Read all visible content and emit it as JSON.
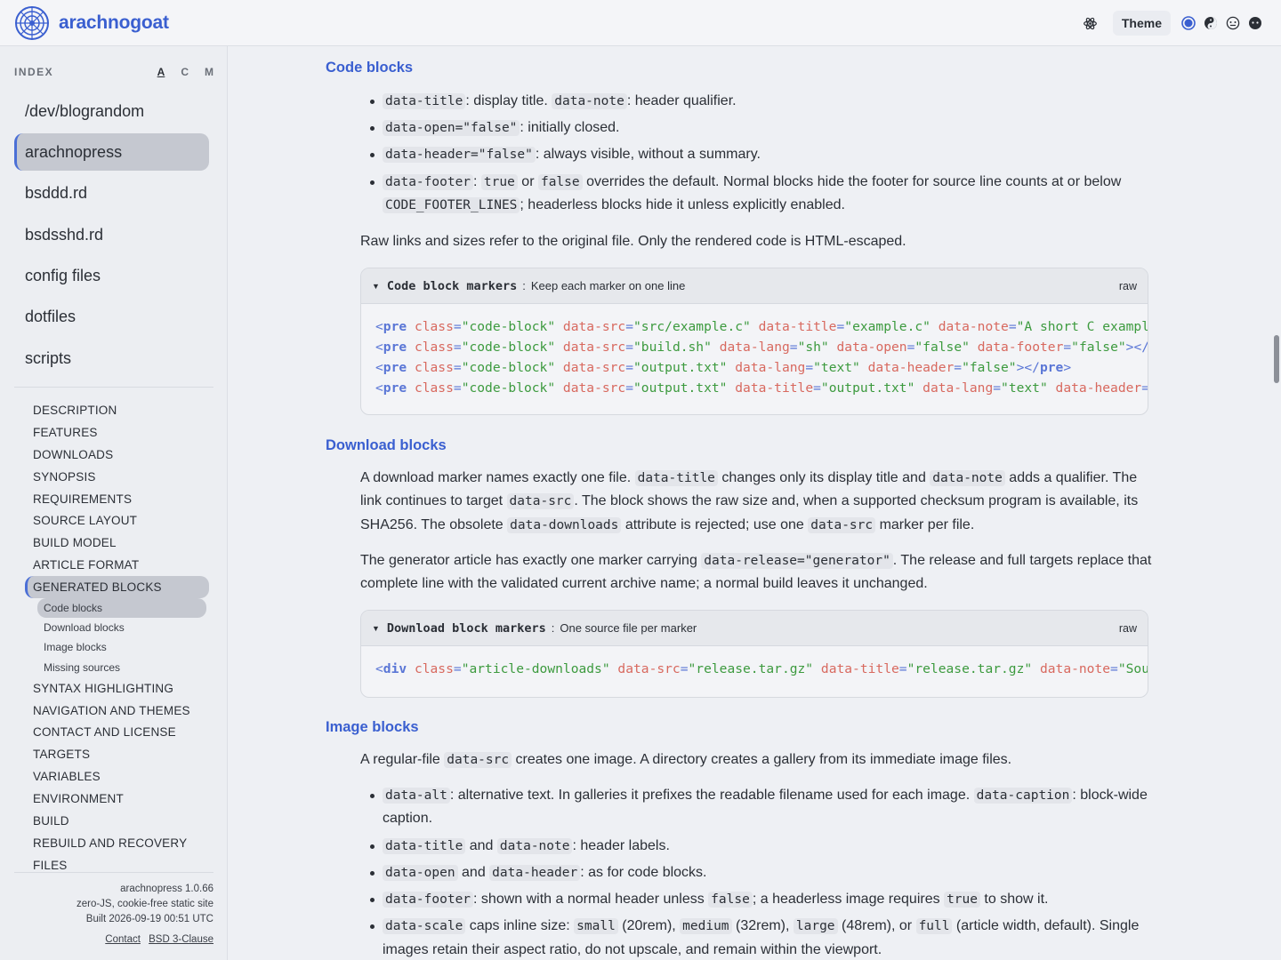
{
  "header": {
    "brand": "arachnogoat",
    "theme_label": "Theme",
    "icons": [
      "atom-icon",
      "radio-selected-icon",
      "yin-yang-icon",
      "face-outline-icon",
      "face-dark-icon"
    ],
    "accent": "#3a5fd0"
  },
  "sidebar": {
    "index_label": "INDEX",
    "sort": [
      "A",
      "C",
      "M"
    ],
    "projects": [
      "/dev/blograndom",
      "arachnopress",
      "bsddd.rd",
      "bsdsshd.rd",
      "config files",
      "dotfiles",
      "scripts"
    ],
    "toc": [
      "DESCRIPTION",
      "FEATURES",
      "DOWNLOADS",
      "SYNOPSIS",
      "REQUIREMENTS",
      "SOURCE LAYOUT",
      "BUILD MODEL",
      "ARTICLE FORMAT",
      "GENERATED BLOCKS"
    ],
    "toc_sub": [
      "Code blocks",
      "Download blocks",
      "Image blocks",
      "Missing sources"
    ],
    "toc_rest": [
      "SYNTAX HIGHLIGHTING",
      "NAVIGATION AND THEMES",
      "CONTACT AND LICENSE",
      "TARGETS",
      "VARIABLES",
      "ENVIRONMENT",
      "BUILD",
      "REBUILD AND RECOVERY",
      "FILES"
    ],
    "footer": {
      "version": "arachnopress 1.0.66",
      "tagline": "zero-JS, cookie-free static site",
      "built": "Built 2026-09-19 00:51 UTC",
      "contact": "Contact",
      "license": "BSD 3-Clause"
    }
  },
  "main": {
    "code_blocks": {
      "heading": "Code blocks",
      "b1_c1": "data-title",
      "b1_t1": ": display title.",
      "b1_c2": "data-note",
      "b1_t2": ": header qualifier.",
      "b2_c1": "data-open=\"false\"",
      "b2_t1": ": initially closed.",
      "b3_c1": "data-header=\"false\"",
      "b3_t1": ": always visible, without a summary.",
      "b4_c1": "data-footer",
      "b4_t1": ": ",
      "b4_c2": "true",
      "b4_t2": " or ",
      "b4_c3": "false",
      "b4_t3": " overrides the default. Normal blocks hide the footer for source line counts at or below ",
      "b4_c4": "CODE_FOOTER_LINES",
      "b4_t4": "; headerless blocks hide it unless explicitly enabled.",
      "para": "Raw links and sizes refer to the original file. Only the rendered code is HTML-escaped.",
      "block_title": "Code block markers",
      "block_note": "Keep each marker on one line",
      "raw": "raw"
    },
    "download_blocks": {
      "heading": "Download blocks",
      "p1_t1": "A download marker names exactly one file. ",
      "p1_c1": "data-title",
      "p1_t2": " changes only its display title and ",
      "p1_c2": "data-note",
      "p1_t3": " adds a qualifier. The link continues to target ",
      "p1_c3": "data-src",
      "p1_t4": ". The block shows the raw size and, when a supported checksum program is available, its SHA256. The obsolete ",
      "p1_c4": "data-downloads",
      "p1_t5": " attribute is rejected; use one ",
      "p1_c5": "data-src",
      "p1_t6": " marker per file.",
      "p2_t1": "The generator article has exactly one marker carrying ",
      "p2_c1": "data-release=\"generator\"",
      "p2_t2": ". The release and full targets replace that complete line with the validated current archive name; a normal build leaves it unchanged.",
      "block_title": "Download block markers",
      "block_note": "One source file per marker",
      "raw": "raw"
    },
    "image_blocks": {
      "heading": "Image blocks",
      "p1_t1": "A regular-file ",
      "p1_c1": "data-src",
      "p1_t2": " creates one image. A directory creates a gallery from its immediate image files.",
      "b1_c1": "data-alt",
      "b1_t1": ": alternative text. In galleries it prefixes the readable filename used for each image. ",
      "b1_c2": "data-caption",
      "b1_t2": ": block-wide caption.",
      "b2_c1": "data-title",
      "b2_t1": " and ",
      "b2_c2": "data-note",
      "b2_t2": ": header labels.",
      "b3_c1": "data-open",
      "b3_t1": " and ",
      "b3_c2": "data-header",
      "b3_t2": ": as for code blocks.",
      "b4_c1": "data-footer",
      "b4_t1": ": shown with a normal header unless ",
      "b4_c2": "false",
      "b4_t2": "; a headerless image requires ",
      "b4_c3": "true",
      "b4_t3": " to show it.",
      "b5_c1": "data-scale",
      "b5_t1": " caps inline size: ",
      "b5_c2": "small",
      "b5_t2": " (20rem), ",
      "b5_c3": "medium",
      "b5_t3": " (32rem), ",
      "b5_c4": "large",
      "b5_t4": " (48rem), or ",
      "b5_c5": "full",
      "b5_t5": " (article width, default). Single images retain their aspect ratio, do not upscale, and remain within the viewport."
    }
  },
  "code_lines": [
    [
      [
        "lt",
        "<"
      ],
      [
        "tn",
        "pre"
      ],
      [
        "sp",
        " "
      ],
      [
        "a",
        "class"
      ],
      [
        "e",
        "="
      ],
      [
        "s",
        "\"code-block\""
      ],
      [
        "sp",
        " "
      ],
      [
        "a",
        "data-src"
      ],
      [
        "e",
        "="
      ],
      [
        "s",
        "\"src/example.c\""
      ],
      [
        "sp",
        " "
      ],
      [
        "a",
        "data-title"
      ],
      [
        "e",
        "="
      ],
      [
        "s",
        "\"example.c\""
      ],
      [
        "sp",
        " "
      ],
      [
        "a",
        "data-note"
      ],
      [
        "e",
        "="
      ],
      [
        "s",
        "\"A short C example\""
      ]
    ],
    [
      [
        "lt",
        "<"
      ],
      [
        "tn",
        "pre"
      ],
      [
        "sp",
        " "
      ],
      [
        "a",
        "class"
      ],
      [
        "e",
        "="
      ],
      [
        "s",
        "\"code-block\""
      ],
      [
        "sp",
        " "
      ],
      [
        "a",
        "data-src"
      ],
      [
        "e",
        "="
      ],
      [
        "s",
        "\"build.sh\""
      ],
      [
        "sp",
        " "
      ],
      [
        "a",
        "data-lang"
      ],
      [
        "e",
        "="
      ],
      [
        "s",
        "\"sh\""
      ],
      [
        "sp",
        " "
      ],
      [
        "a",
        "data-open"
      ],
      [
        "e",
        "="
      ],
      [
        "s",
        "\"false\""
      ],
      [
        "sp",
        " "
      ],
      [
        "a",
        "data-footer"
      ],
      [
        "e",
        "="
      ],
      [
        "s",
        "\"false\""
      ],
      [
        "lt",
        "></"
      ],
      [
        "tn",
        "pre"
      ],
      [
        "lt",
        ">"
      ]
    ],
    [
      [
        "lt",
        "<"
      ],
      [
        "tn",
        "pre"
      ],
      [
        "sp",
        " "
      ],
      [
        "a",
        "class"
      ],
      [
        "e",
        "="
      ],
      [
        "s",
        "\"code-block\""
      ],
      [
        "sp",
        " "
      ],
      [
        "a",
        "data-src"
      ],
      [
        "e",
        "="
      ],
      [
        "s",
        "\"output.txt\""
      ],
      [
        "sp",
        " "
      ],
      [
        "a",
        "data-lang"
      ],
      [
        "e",
        "="
      ],
      [
        "s",
        "\"text\""
      ],
      [
        "sp",
        " "
      ],
      [
        "a",
        "data-header"
      ],
      [
        "e",
        "="
      ],
      [
        "s",
        "\"false\""
      ],
      [
        "lt",
        "></"
      ],
      [
        "tn",
        "pre"
      ],
      [
        "lt",
        ">"
      ]
    ],
    [
      [
        "lt",
        "<"
      ],
      [
        "tn",
        "pre"
      ],
      [
        "sp",
        " "
      ],
      [
        "a",
        "class"
      ],
      [
        "e",
        "="
      ],
      [
        "s",
        "\"code-block\""
      ],
      [
        "sp",
        " "
      ],
      [
        "a",
        "data-src"
      ],
      [
        "e",
        "="
      ],
      [
        "s",
        "\"output.txt\""
      ],
      [
        "sp",
        " "
      ],
      [
        "a",
        "data-title"
      ],
      [
        "e",
        "="
      ],
      [
        "s",
        "\"output.txt\""
      ],
      [
        "sp",
        " "
      ],
      [
        "a",
        "data-lang"
      ],
      [
        "e",
        "="
      ],
      [
        "s",
        "\"text\""
      ],
      [
        "sp",
        " "
      ],
      [
        "a",
        "data-header"
      ],
      [
        "e",
        "="
      ],
      [
        "s",
        "\"false\""
      ]
    ]
  ],
  "download_lines": [
    [
      [
        "lt",
        "<"
      ],
      [
        "tn",
        "div"
      ],
      [
        "sp",
        " "
      ],
      [
        "a",
        "class"
      ],
      [
        "e",
        "="
      ],
      [
        "s",
        "\"article-downloads\""
      ],
      [
        "sp",
        " "
      ],
      [
        "a",
        "data-src"
      ],
      [
        "e",
        "="
      ],
      [
        "s",
        "\"release.tar.gz\""
      ],
      [
        "sp",
        " "
      ],
      [
        "a",
        "data-title"
      ],
      [
        "e",
        "="
      ],
      [
        "s",
        "\"release.tar.gz\""
      ],
      [
        "sp",
        " "
      ],
      [
        "a",
        "data-note"
      ],
      [
        "e",
        "="
      ],
      [
        "s",
        "\"Source\""
      ]
    ]
  ]
}
